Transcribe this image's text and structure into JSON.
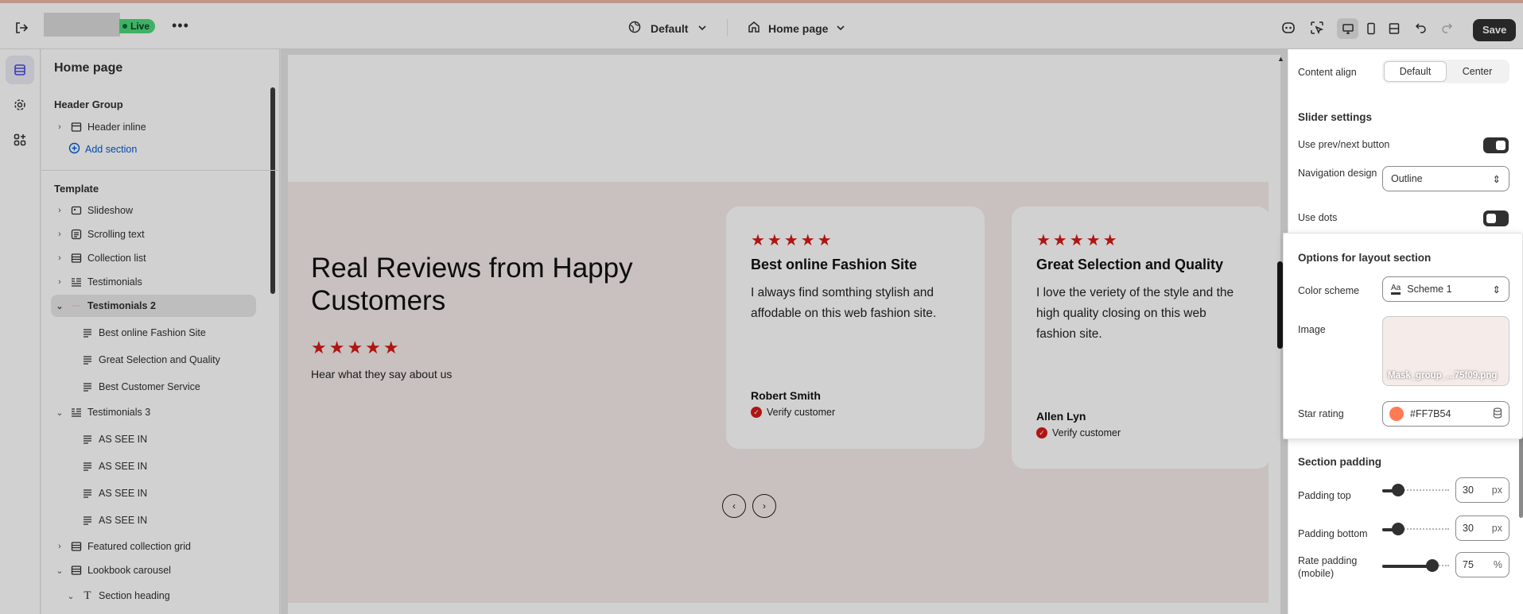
{
  "topbar": {
    "live_badge": "Live",
    "more_label": "•••",
    "theme_select": "Default",
    "page_select": "Home page",
    "save_label": "Save"
  },
  "left_panel": {
    "title": "Home page",
    "header_group": {
      "title": "Header Group",
      "items": [
        {
          "label": "Header inline"
        }
      ],
      "add_section": "Add section"
    },
    "template": {
      "title": "Template",
      "items": [
        {
          "label": "Slideshow"
        },
        {
          "label": "Scrolling text"
        },
        {
          "label": "Collection list"
        },
        {
          "label": "Testimonials"
        },
        {
          "label": "Testimonials 2"
        },
        {
          "label": "Best online Fashion Site"
        },
        {
          "label": "Great Selection and Quality"
        },
        {
          "label": "Best Customer Service"
        },
        {
          "label": "Testimonials 3"
        },
        {
          "label": "AS SEE IN"
        },
        {
          "label": "AS SEE IN"
        },
        {
          "label": "AS SEE IN"
        },
        {
          "label": "AS SEE IN"
        },
        {
          "label": "Featured collection grid"
        },
        {
          "label": "Lookbook carousel"
        },
        {
          "label": "Section heading"
        }
      ]
    }
  },
  "preview": {
    "heading": "Real Reviews from Happy Customers",
    "stars": "★★★★★",
    "subheading": "Hear what they say about us",
    "cards": [
      {
        "stars": "★★★★★",
        "title": "Best online Fashion Site",
        "body": "I always find somthing stylish and affodable on this web fashion site.",
        "author": "Robert Smith",
        "verify": "Verify customer"
      },
      {
        "stars": "★★★★★",
        "title": "Great Selection and Quality",
        "body": "I love the veriety of the style and the high quality closing on this web fashion site.",
        "author": "Allen Lyn",
        "verify": "Verify customer"
      }
    ],
    "prev_arrow": "‹",
    "next_arrow": "›"
  },
  "right_panel": {
    "content_align_label": "Content align",
    "content_align_options": [
      "Default",
      "Center"
    ],
    "slider_settings_title": "Slider settings",
    "use_prev_next_label": "Use prev/next button",
    "navigation_design_label": "Navigation design",
    "navigation_design_value": "Outline",
    "use_dots_label": "Use dots",
    "layout_options_title": "Options for layout section",
    "color_scheme_label": "Color scheme",
    "color_scheme_value": "Scheme 1",
    "color_scheme_icon_text": "Aa",
    "image_label": "Image",
    "image_filename": "Mask_group_...75f09.png",
    "star_rating_label": "Star rating",
    "star_rating_value": "#FF7B54",
    "star_rating_color": "#FF7B54",
    "section_padding_title": "Section padding",
    "padding_top_label": "Padding top",
    "padding_top_value": "30",
    "padding_top_unit": "px",
    "padding_bottom_label": "Padding bottom",
    "padding_bottom_value": "30",
    "padding_bottom_unit": "px",
    "rate_padding_label": "Rate padding (mobile)",
    "rate_padding_value": "75",
    "rate_padding_unit": "%"
  },
  "colors": {
    "accent_blue": "#005bd3",
    "star_red": "#d61a16",
    "live_green": "#4dd87c",
    "preview_bg": "#f5ece9"
  }
}
